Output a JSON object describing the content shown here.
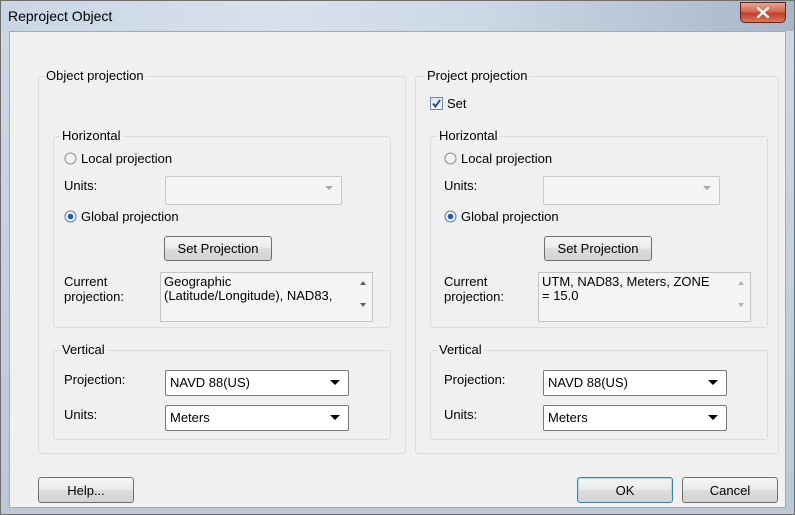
{
  "window": {
    "title": "Reproject Object"
  },
  "object_projection": {
    "group_label": "Object projection",
    "horizontal": {
      "group_label": "Horizontal",
      "local_label": "Local projection",
      "units_label": "Units:",
      "units_value": "",
      "global_label": "Global projection",
      "selected": "global",
      "set_projection_label": "Set Projection",
      "current_label": "Current\nprojection:",
      "current_value": "Geographic\n(Latitude/Longitude), NAD83,"
    },
    "vertical": {
      "group_label": "Vertical",
      "projection_label": "Projection:",
      "projection_value": "NAVD 88(US)",
      "units_label": "Units:",
      "units_value": "Meters"
    }
  },
  "project_projection": {
    "group_label": "Project projection",
    "set_label": "Set",
    "set_checked": true,
    "horizontal": {
      "group_label": "Horizontal",
      "local_label": "Local projection",
      "units_label": "Units:",
      "units_value": "",
      "global_label": "Global projection",
      "selected": "global",
      "set_projection_label": "Set Projection",
      "current_label": "Current\nprojection:",
      "current_value": "UTM, NAD83, Meters, ZONE\n= 15.0"
    },
    "vertical": {
      "group_label": "Vertical",
      "projection_label": "Projection:",
      "projection_value": "NAVD 88(US)",
      "units_label": "Units:",
      "units_value": "Meters"
    }
  },
  "buttons": {
    "help": "Help...",
    "ok": "OK",
    "cancel": "Cancel"
  },
  "colors": {
    "accent": "#3c7fb1",
    "close_button": "#c23e28",
    "dialog_bg": "#f0f0f0"
  }
}
